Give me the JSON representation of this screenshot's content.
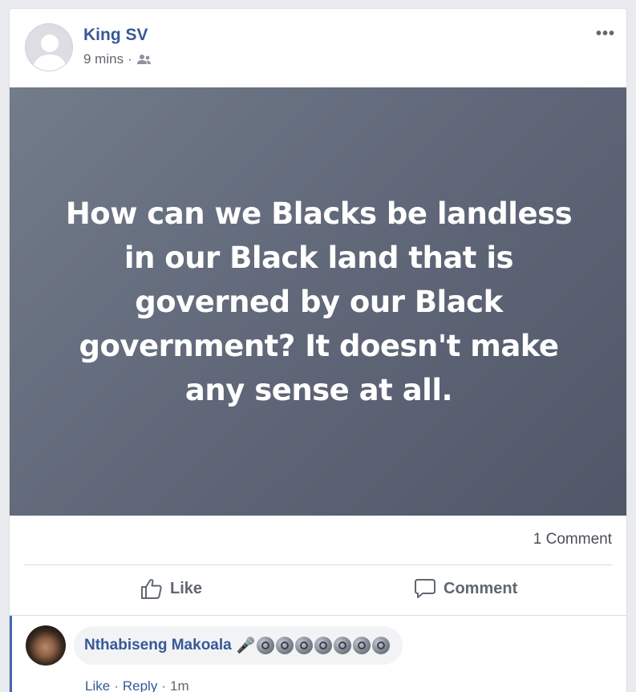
{
  "post": {
    "author": "King SV",
    "time": "9 mins",
    "audience_icon": "friends-icon",
    "menu_icon": "more-options-icon",
    "text": "How can we Blacks be landless in our Black land that is governed by our Black government? It doesn't make any sense at all.",
    "background_colors": [
      "#737c8b",
      "#505768"
    ]
  },
  "stats": {
    "comments": "1 Comment"
  },
  "actions": {
    "like": "Like",
    "comment": "Comment"
  },
  "comment": {
    "author": "Nthabiseng Makoala",
    "emoji": "🎤",
    "emoji_speakers_count": 7,
    "like": "Like",
    "reply": "Reply",
    "time": "1m"
  },
  "colors": {
    "link": "#385898",
    "accent": "#4267b2",
    "muted": "#616770"
  }
}
